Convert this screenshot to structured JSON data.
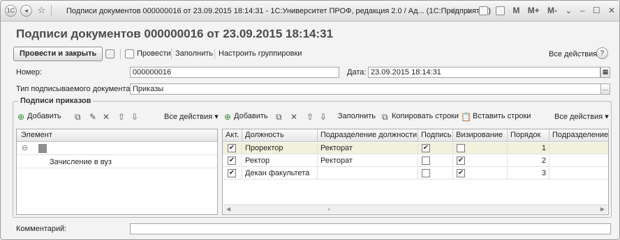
{
  "window": {
    "title": "Подписи документов 000000016 от 23.09.2015 18:14:31 - 1С:Университет ПРОФ, редакция 2.0 / Ад... (1С:Предприятие)",
    "logo": "1С",
    "right_buttons": [
      "M",
      "M+",
      "M-"
    ]
  },
  "header": {
    "title": "Подписи документов 000000016 от 23.09.2015 18:14:31"
  },
  "commandbar": {
    "post_close_label": "Провести и закрыть",
    "post_label": "Провести",
    "fill_label": "Заполнить",
    "groupings_label": "Настроить группировки",
    "all_actions_label": "Все действия ▾",
    "help_label": "?"
  },
  "fields": {
    "number_label": "Номер:",
    "number_value": "000000016",
    "date_label": "Дата:",
    "date_value": "23.09.2015 18:14:31",
    "doc_type_label": "Тип подписываемого документа:",
    "doc_type_value": "Приказы",
    "comment_label": "Комментарий:",
    "comment_value": ""
  },
  "group": {
    "title": "Подписи приказов",
    "left_toolbar": {
      "add_label": "Добавить",
      "all_actions_label": "Все действия ▾"
    },
    "right_toolbar": {
      "add_label": "Добавить",
      "fill_label": "Заполнить",
      "copy_rows_label": "Копировать строки",
      "paste_rows_label": "Вставить строки",
      "all_actions_label": "Все действия ▾"
    }
  },
  "tree": {
    "header": "Элемент",
    "rows": [
      {
        "label": ""
      },
      {
        "label": "Зачисление в вуз"
      }
    ]
  },
  "grid": {
    "columns": [
      "Акт.",
      "Должность",
      "Подразделение должности",
      "Подпись",
      "Визирование",
      "Порядок",
      "Подразделение"
    ],
    "rows": [
      {
        "active": "✔",
        "position": "Проректор",
        "department": "Ректорат",
        "signature": "✔",
        "visa": "",
        "order": "1",
        "unit": ""
      },
      {
        "active": "✔",
        "position": "Ректор",
        "department": "Ректорат",
        "signature": "",
        "visa": "✔",
        "order": "2",
        "unit": ""
      },
      {
        "active": "✔",
        "position": "Декан факультета",
        "department": "",
        "signature": "",
        "visa": "✔",
        "order": "3",
        "unit": ""
      }
    ]
  },
  "icons": [
    "back-icon",
    "forward-icon",
    "star-icon",
    "save-icon",
    "post-icon",
    "add-icon",
    "copy-icon",
    "edit-icon",
    "delete-icon",
    "move-up-icon",
    "move-down-icon",
    "paste-icon",
    "calendar-icon",
    "ellipsis-icon",
    "help-icon"
  ]
}
